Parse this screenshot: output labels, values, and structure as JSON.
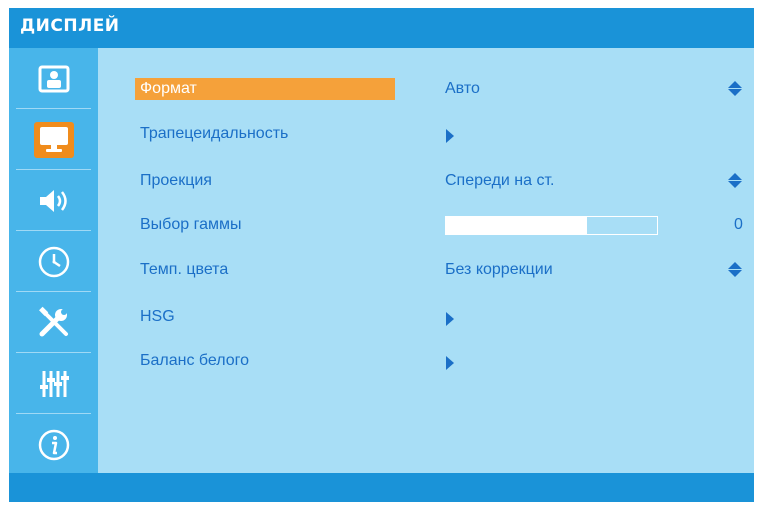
{
  "header": {
    "title": "ДИСПЛЕЙ"
  },
  "sidebar": {
    "items": [
      {
        "icon": "picture-icon",
        "active": false
      },
      {
        "icon": "display-icon",
        "active": true
      },
      {
        "icon": "speaker-icon",
        "active": false
      },
      {
        "icon": "clock-icon",
        "active": false
      },
      {
        "icon": "tools-icon",
        "active": false
      },
      {
        "icon": "equalizer-icon",
        "active": false
      },
      {
        "icon": "info-icon",
        "active": false
      }
    ]
  },
  "menu": {
    "format": {
      "label": "Формат",
      "value": "Авто"
    },
    "keystone": {
      "label": "Трапецеидальность"
    },
    "projection": {
      "label": "Проекция",
      "value": "Спереди на ст."
    },
    "gamma": {
      "label": "Выбор гаммы",
      "value": "0",
      "level_percent": 67
    },
    "color_temp": {
      "label": "Темп. цвета",
      "value": "Без коррекции"
    },
    "hsg": {
      "label": "HSG"
    },
    "white_balance": {
      "label": "Баланс белого"
    }
  },
  "colors": {
    "header": "#1a93d8",
    "panel": "#a8def6",
    "sidebar": "#48b5ea",
    "highlight": "#f5a13a",
    "active_icon": "#f08c1c",
    "text": "#1b6fc7"
  }
}
